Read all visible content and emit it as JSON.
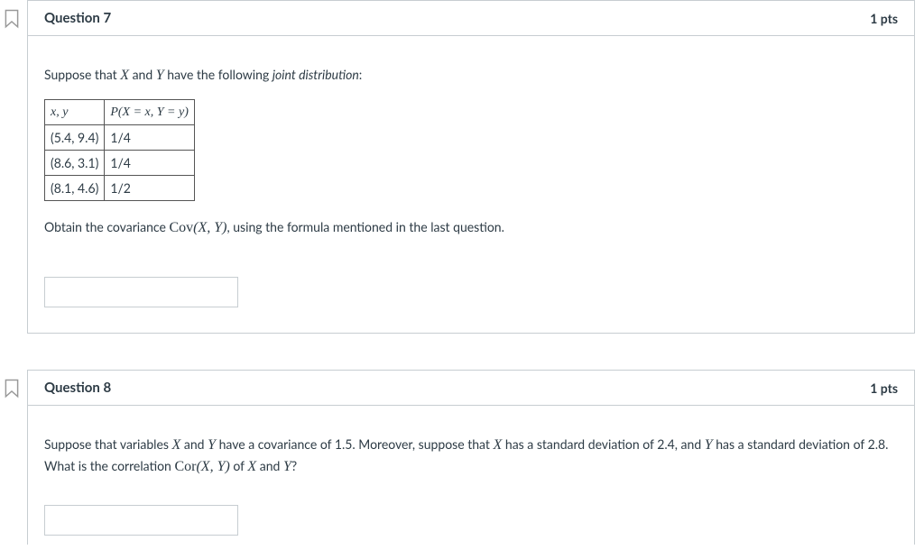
{
  "q7": {
    "title": "Question 7",
    "points": "1 pts",
    "intro_prefix": "Suppose that ",
    "intro_mid": " and ",
    "intro_suffix": " have the following ",
    "intro_link": "joint distribution",
    "intro_end": ":",
    "table": {
      "h1": "x, y",
      "h2": "P(X = x, Y = y)",
      "rows": [
        {
          "xy": "(5.4, 9.4)",
          "p": "1/4"
        },
        {
          "xy": "(8.6, 3.1)",
          "p": "1/4"
        },
        {
          "xy": "(8.1, 4.6)",
          "p": "1/2"
        }
      ]
    },
    "instr_prefix": "Obtain the covariance ",
    "instr_cov": "Cov(X, Y)",
    "instr_suffix": ", using the formula mentioned in the last question."
  },
  "q8": {
    "title": "Question 8",
    "points": "1 pts",
    "p1_a": "Suppose that variables ",
    "p1_b": " and ",
    "p1_c": " have a covariance of 1.5. Moreover, suppose that ",
    "p1_d": " has a standard deviation of 2.4, and ",
    "p1_e": " has a standard deviation of 2.8. What is the correlation ",
    "p1_cor": "Cor(X, Y)",
    "p1_f": " of ",
    "p1_g": " and ",
    "p1_h": "?"
  },
  "vars": {
    "X": "X",
    "Y": "Y"
  }
}
